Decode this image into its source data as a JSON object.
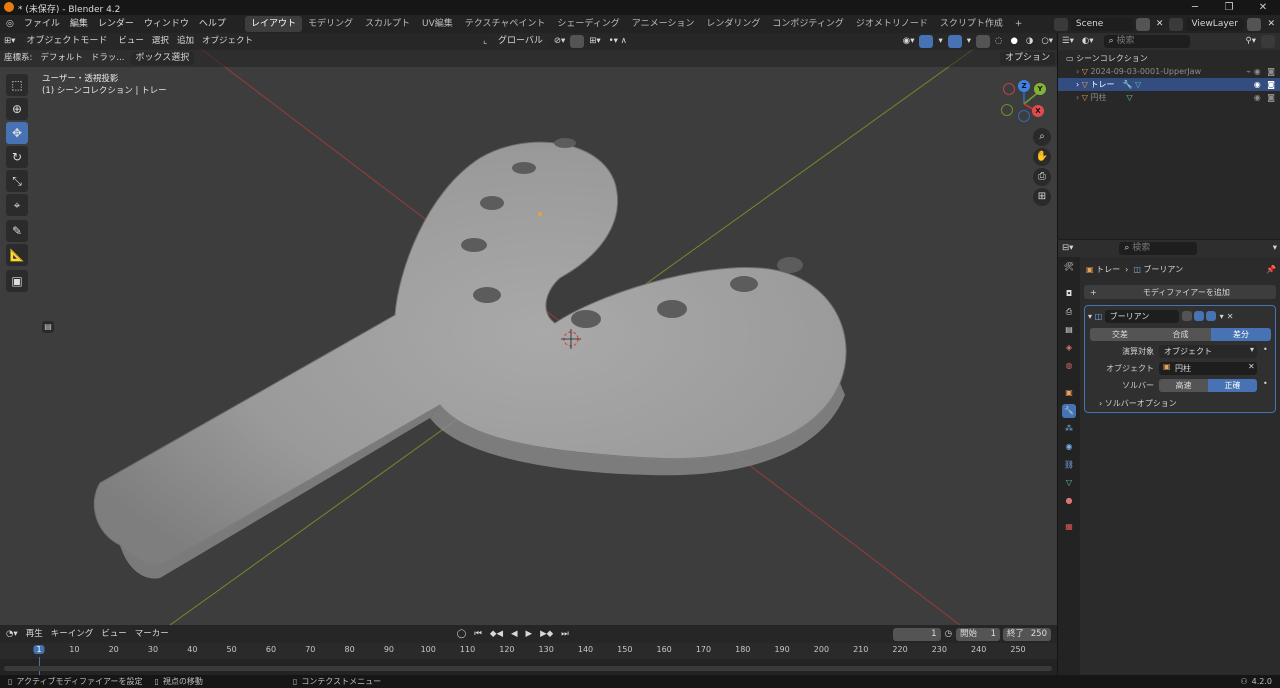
{
  "titlebar": {
    "title": "* (未保存) - Blender 4.2",
    "minimize": "─",
    "maximize": "❐",
    "close": "✕"
  },
  "menubar": {
    "menus": [
      "ファイル",
      "編集",
      "レンダー",
      "ウィンドウ",
      "ヘルプ"
    ],
    "workspaces": [
      "レイアウト",
      "モデリング",
      "スカルプト",
      "UV編集",
      "テクスチャペイント",
      "シェーディング",
      "アニメーション",
      "レンダリング",
      "コンポジティング",
      "ジオメトリノード",
      "スクリプト作成"
    ],
    "active_workspace": 0,
    "add_tab": "+",
    "scene": "Scene",
    "view_layer": "ViewLayer"
  },
  "viewport": {
    "mode": "オブジェクトモード",
    "menus": [
      "ビュー",
      "選択",
      "追加",
      "オブジェクト"
    ],
    "transform_orientation": "グローバル",
    "coordinate_label": "座標系:",
    "coordinate_value": "デフォルト",
    "drag_label": "ドラッ...",
    "box_select": "ボックス選択",
    "options": "オプション",
    "view_name": "ユーザー・透視投影",
    "collection_info": "(1) シーンコレクション | トレー"
  },
  "gizmo": {
    "z": "Z",
    "y": "Y",
    "x": "X"
  },
  "outliner": {
    "search_placeholder": "検索",
    "root": "シーンコレクション",
    "items": [
      {
        "name": "2024-09-03-0001-UpperJaw",
        "selected": false
      },
      {
        "name": "トレー",
        "selected": true
      },
      {
        "name": "円柱",
        "selected": false
      }
    ]
  },
  "properties": {
    "search_placeholder": "検索",
    "breadcrumb_object": "トレー",
    "breadcrumb_sep": "›",
    "breadcrumb_modifier": "ブーリアン",
    "add_modifier": "モディファイアーを追加",
    "modifier_name": "ブーリアン",
    "operations": [
      "交差",
      "合成",
      "差分"
    ],
    "active_operation": 2,
    "operand_label": "演算対象",
    "operand_value": "オブジェクト",
    "object_label": "オブジェクト",
    "object_value": "円柱",
    "solver_label": "ソルバー",
    "solver_options": [
      "高速",
      "正確"
    ],
    "active_solver": 1,
    "solver_options_panel": "ソルバーオプション"
  },
  "timeline": {
    "menus": [
      "再生",
      "キーイング",
      "ビュー",
      "マーカー"
    ],
    "current_frame": "1",
    "start_label": "開始",
    "start_value": "1",
    "end_label": "終了",
    "end_value": "250",
    "ticks": [
      "1",
      "10",
      "20",
      "30",
      "40",
      "50",
      "60",
      "70",
      "80",
      "90",
      "100",
      "110",
      "120",
      "130",
      "140",
      "150",
      "160",
      "170",
      "180",
      "190",
      "200",
      "210",
      "220",
      "230",
      "240",
      "250"
    ]
  },
  "statusbar": {
    "hint1": "アクティブモディファイアーを設定",
    "hint2": "視点の移動",
    "hint3": "コンテクストメニュー",
    "version": "4.2.0"
  }
}
